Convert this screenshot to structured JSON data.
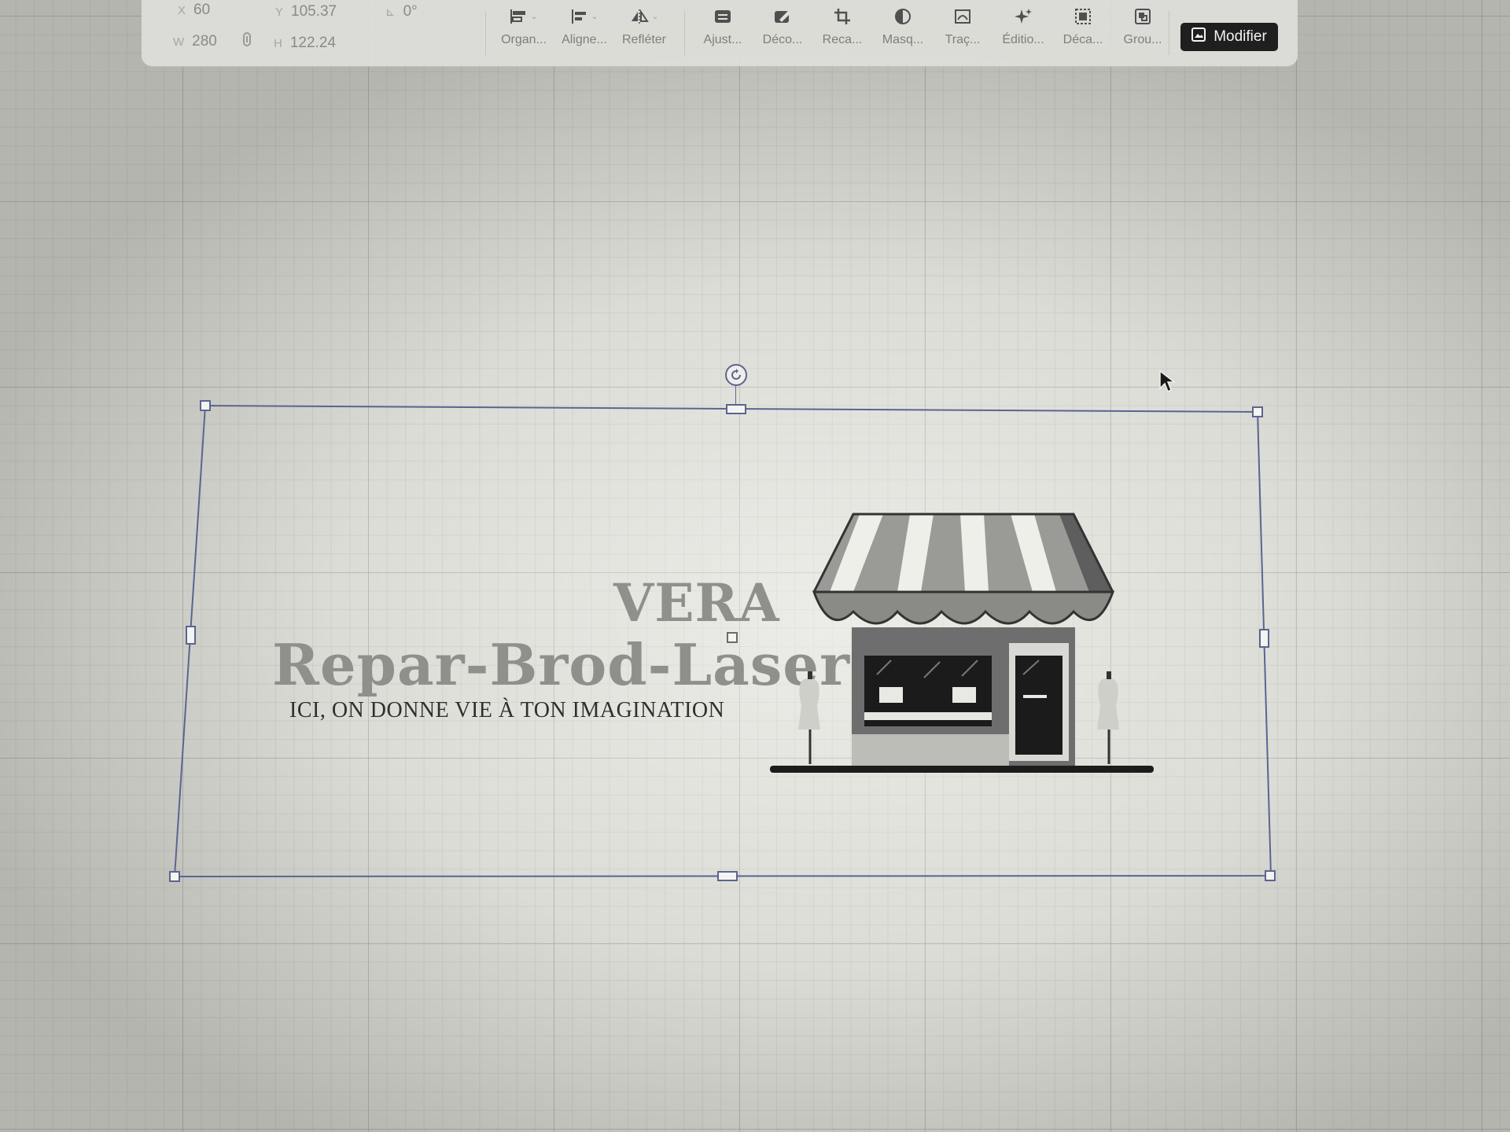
{
  "coords": {
    "x_label": "X",
    "x_value": "60",
    "y_label": "Y",
    "y_value": "105.37",
    "rotation_label": "⊾",
    "rotation_value": "0°",
    "w_label": "W",
    "w_value": "280",
    "h_label": "H",
    "h_value": "122.24"
  },
  "toolbar": {
    "tools": [
      {
        "label": "Organ...",
        "icon": "arrange-icon"
      },
      {
        "label": "Aligne...",
        "icon": "align-icon"
      },
      {
        "label": "Refléter",
        "icon": "flip-icon"
      },
      {
        "label": "Ajust...",
        "icon": "adjust-icon"
      },
      {
        "label": "Déco...",
        "icon": "decorate-icon"
      },
      {
        "label": "Reca...",
        "icon": "crop-icon"
      },
      {
        "label": "Masq...",
        "icon": "mask-icon"
      },
      {
        "label": "Traç...",
        "icon": "trace-icon"
      },
      {
        "label": "Éditio...",
        "icon": "magic-edit-icon"
      },
      {
        "label": "Déca...",
        "icon": "offset-icon"
      },
      {
        "label": "Grou...",
        "icon": "group-icon"
      }
    ],
    "modify_label": "Modifier"
  },
  "logo": {
    "line1": "VERA",
    "line2": "Repar-Brod-Laser",
    "tagline": "ICI, ON DONNE VIE À TON IMAGINATION"
  },
  "colors": {
    "selection": "#5a6590",
    "brand_text": "#8f8f8b",
    "tagline_text": "#2f2f2d",
    "button_bg": "#1f1f1f"
  }
}
